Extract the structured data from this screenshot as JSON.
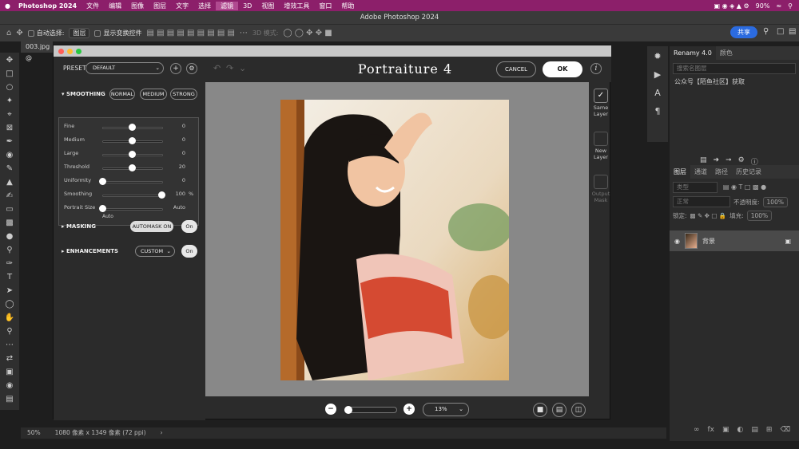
{
  "menubar": {
    "apple": "",
    "app": "Photoshop 2024",
    "items": [
      "文件",
      "编辑",
      "图像",
      "图层",
      "文字",
      "选择",
      "滤镜",
      "3D",
      "视图",
      "增效工具",
      "窗口",
      "帮助"
    ],
    "battery": "90%"
  },
  "window": {
    "title": "Adobe Photoshop 2024"
  },
  "options": {
    "auto_select": "自动选择:",
    "layer_select": "图层",
    "show_transform": "显示变换控件",
    "mode_3d": "3D 模式:",
    "share": "共享"
  },
  "document": {
    "tab": "003.jpg @",
    "zoom": "50%",
    "info": "1080 像素 x 1349 像素 (72 ppi)"
  },
  "right_panel": {
    "top_tabs": [
      "Renamy 4.0",
      "颜色"
    ],
    "search_placeholder": "搜索名图层",
    "promo": "公众号【陌鱼社区】获取",
    "layer_tabs": [
      "图层",
      "通道",
      "路径",
      "历史记录"
    ],
    "filter_kind": "类型",
    "blend_mode": "正常",
    "opacity_label": "不透明度:",
    "opacity_value": "100%",
    "lock_label": "锁定:",
    "fill_label": "填充:",
    "fill_value": "100%",
    "layer_name": "背景"
  },
  "plugin": {
    "title": "Portraiture 4",
    "cancel": "CANCEL",
    "ok": "OK",
    "preset_label": "PRESET",
    "preset_value": "DEFAULT",
    "smoothing_header": "SMOOTHING",
    "smoothing_modes": [
      "NORMAL",
      "MEDIUM",
      "STRONG"
    ],
    "sliders": [
      {
        "name": "Fine",
        "value": "0",
        "pos": 0.5
      },
      {
        "name": "Medium",
        "value": "0",
        "pos": 0.5
      },
      {
        "name": "Large",
        "value": "0",
        "pos": 0.5
      },
      {
        "name": "Threshold",
        "value": "20",
        "pos": 0.5
      },
      {
        "name": "Uniformity",
        "value": "0",
        "pos": 0.0
      },
      {
        "name": "Smoothing",
        "value": "100",
        "unit": "%",
        "pos": 1.0
      },
      {
        "name": "Portrait Size",
        "value": "Auto",
        "pos": 0.0
      }
    ],
    "portrait_size_below": "Auto",
    "masking_header": "MASKING",
    "automask": "AUTOMASK ON",
    "masking_toggle": "On",
    "enhancements_header": "ENHANCEMENTS",
    "enh_mode": "CUSTOM",
    "enh_toggle": "On",
    "side_options": [
      {
        "label": "Same Layer",
        "checked": true
      },
      {
        "label": "New Layer",
        "checked": false
      },
      {
        "label": "Output Mask",
        "checked": false
      }
    ],
    "zoom_value": "13%"
  }
}
